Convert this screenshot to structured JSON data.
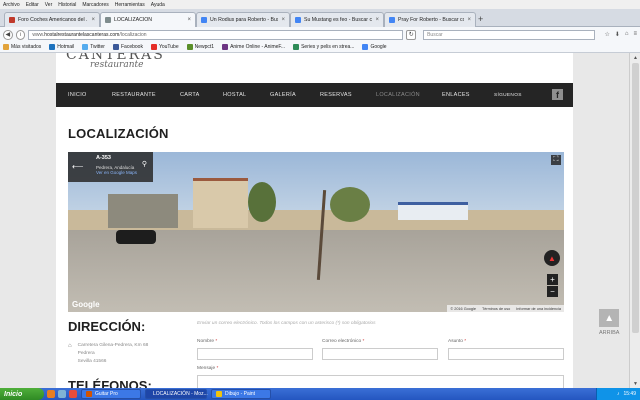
{
  "menubar": {
    "items": [
      "Archivo",
      "Editar",
      "Ver",
      "Historial",
      "Marcadores",
      "Herramientas",
      "Ayuda"
    ]
  },
  "tabs": [
    {
      "label": "Foro Coches Americanos del ...",
      "color": "#c0392b",
      "active": false
    },
    {
      "label": "LOCALIZACIÓN",
      "color": "#7f8c8d",
      "active": true
    },
    {
      "label": "Un Rodius para Roberto - Bus...",
      "color": "#4285f4",
      "active": false
    },
    {
      "label": "Su Mustang es feo - Buscar c...",
      "color": "#4285f4",
      "active": false
    },
    {
      "label": "Pray For Roberto - Buscar co...",
      "color": "#4285f4",
      "active": false
    }
  ],
  "navbar": {
    "url_prefix": "www.",
    "url_host": "hostalrestaurantelascanteras.com",
    "url_path": "/localizacion",
    "search_placeholder": "Buscar"
  },
  "bookmarks": [
    {
      "label": "Más visitados",
      "color": "#e2a33b"
    },
    {
      "label": "Hotmail",
      "color": "#1e73be"
    },
    {
      "label": "Twitter",
      "color": "#55acee"
    },
    {
      "label": "Facebook",
      "color": "#3b5998"
    },
    {
      "label": "YouTube",
      "color": "#e52d27"
    },
    {
      "label": "Newpct1",
      "color": "#5a8f29"
    },
    {
      "label": "Anime Online - AnimeF...",
      "color": "#6c3483"
    },
    {
      "label": "Series y pelis en strea...",
      "color": "#2e8b57"
    },
    {
      "label": "Google",
      "color": "#4285f4"
    }
  ],
  "site": {
    "logo_line1": "CANTERAS",
    "logo_line2": "restaurante",
    "nav": [
      {
        "label": "INICIO",
        "active": false
      },
      {
        "label": "RESTAURANTE",
        "active": false
      },
      {
        "label": "CARTA",
        "active": false
      },
      {
        "label": "HOSTAL",
        "active": false
      },
      {
        "label": "GALERÍA",
        "active": false
      },
      {
        "label": "RESERVAS",
        "active": false
      },
      {
        "label": "LOCALIZACIÓN",
        "active": true
      },
      {
        "label": "ENLACES",
        "active": false
      },
      {
        "label": "SÍGUENOS",
        "active": false
      }
    ],
    "page_title": "LOCALIZACIÓN"
  },
  "map": {
    "road": "A-353",
    "place": "Pedrera, Andalucía",
    "link": "Ver en Google Maps",
    "google": "Google",
    "footer": [
      "© 2016 Google",
      "Términos de uso",
      "Informar de una incidencia"
    ],
    "zoom_in": "+",
    "zoom_out": "−"
  },
  "address": {
    "heading": "DIRECCIÓN:",
    "lines": [
      "Carretera Gilena-Pedrera, Km 68",
      "Pedrera",
      "Sevilla 41566"
    ]
  },
  "telefonos_heading": "TELÉFONOS:",
  "form": {
    "note": "Enviar un correo electrónico. Todos los campos con un asterisco (*) son obligatorios",
    "nombre": "Nombre",
    "email": "Correo electrónico",
    "asunto": "Asunto",
    "mensaje": "Mensaje",
    "required_mark": "*"
  },
  "arriba": {
    "label": "ARRIBA",
    "arrow": "▲"
  },
  "taskbar": {
    "start": "Inicio",
    "tasks": [
      {
        "label": "Guitar Pro",
        "color": "#d35400",
        "active": false
      },
      {
        "label": "LOCALIZACIÓN - Moz...",
        "color": "#e67e22",
        "active": true
      },
      {
        "label": "Dibujo - Paint",
        "color": "#f1c40f",
        "active": false
      }
    ],
    "clock": "15:49"
  }
}
